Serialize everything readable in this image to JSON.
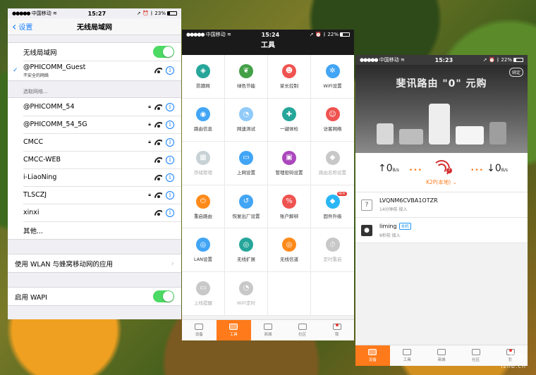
{
  "phone1": {
    "status": {
      "carrier": "中国移动",
      "time": "15:27",
      "battery": "23%",
      "battery_level": 0.23
    },
    "nav": {
      "back_label": "设置",
      "title": "无线局域网"
    },
    "wifi_toggle_label": "无线局域网",
    "connected": {
      "name": "@PHICOMM_Guest",
      "subtitle": "不安全的网络"
    },
    "choose_header": "选取网络...",
    "networks": [
      {
        "name": "@PHICOMM_54",
        "locked": true
      },
      {
        "name": "@PHICOMM_54_5G",
        "locked": true
      },
      {
        "name": "CMCC",
        "locked": true
      },
      {
        "name": "CMCC-WEB",
        "locked": false
      },
      {
        "name": "i-LiaoNing",
        "locked": false
      },
      {
        "name": "TLSCZJ",
        "locked": true
      },
      {
        "name": "xinxi",
        "locked": false
      }
    ],
    "other_label": "其他...",
    "wlan_apps_label": "使用 WLAN 与蜂窝移动网的应用",
    "wapi_label": "启用 WAPI"
  },
  "phone2": {
    "status": {
      "carrier": "中国移动",
      "time": "15:24",
      "battery": "22%",
      "battery_level": 0.22
    },
    "title": "工具",
    "tools": [
      {
        "label": "防蹭网",
        "icon": "shield-wifi-icon",
        "color": "#26a69a"
      },
      {
        "label": "绿色节能",
        "icon": "leaf-icon",
        "color": "#43a047"
      },
      {
        "label": "家长控制",
        "icon": "parent-control-icon",
        "color": "#ef5350"
      },
      {
        "label": "WiFi设置",
        "icon": "gear-icon",
        "color": "#42a5f5"
      },
      {
        "label": "路由信息",
        "icon": "globe-icon",
        "color": "#42a5f5"
      },
      {
        "label": "网速测试",
        "icon": "speedometer-icon",
        "color": "#90caf9"
      },
      {
        "label": "一键体检",
        "icon": "medical-cross-icon",
        "color": "#26a69a"
      },
      {
        "label": "访客网络",
        "icon": "guest-users-icon",
        "color": "#ef5350"
      },
      {
        "label": "存储管理",
        "icon": "storage-icon",
        "color": "#c8d2d6",
        "disabled": true
      },
      {
        "label": "上网设置",
        "icon": "network-setup-icon",
        "color": "#42a5f5"
      },
      {
        "label": "管理密码设置",
        "icon": "lock-icon",
        "color": "#ab47bc"
      },
      {
        "label": "路由名称设置",
        "icon": "tag-icon",
        "color": "#c8c8c8",
        "disabled": true
      },
      {
        "label": "重启路由",
        "icon": "restart-icon",
        "color": "#ff8a1a"
      },
      {
        "label": "恢复出厂设置",
        "icon": "factory-reset-icon",
        "color": "#42a5f5"
      },
      {
        "label": "账户解绑",
        "icon": "unbind-icon",
        "color": "#ef5350"
      },
      {
        "label": "固件升级",
        "icon": "diamond-icon",
        "color": "#29b6f6",
        "badge": "NEW"
      },
      {
        "label": "LAN设置",
        "icon": "lan-icon",
        "color": "#42a5f5"
      },
      {
        "label": "无线扩展",
        "icon": "wireless-extend-icon",
        "color": "#26a69a"
      },
      {
        "label": "无线信道",
        "icon": "wireless-channel-icon",
        "color": "#ff8a1a"
      },
      {
        "label": "定时重启",
        "icon": "timer-restart-icon",
        "color": "#c8c8c8",
        "disabled": true
      },
      {
        "label": "上线提醒",
        "icon": "online-alert-icon",
        "color": "#c8c8c8",
        "disabled": true
      },
      {
        "label": "WiFi定时",
        "icon": "wifi-timer-icon",
        "color": "#c8c8c8",
        "disabled": true
      },
      {
        "label": "",
        "icon": "",
        "color": ""
      },
      {
        "label": "",
        "icon": "",
        "color": ""
      }
    ],
    "tabs": [
      {
        "label": "设备",
        "icon": "device-icon",
        "active": false
      },
      {
        "label": "工具",
        "icon": "toolbox-icon",
        "active": true
      },
      {
        "label": "商城",
        "icon": "store-icon",
        "active": false
      },
      {
        "label": "社区",
        "icon": "community-icon",
        "active": false
      },
      {
        "label": "我",
        "icon": "profile-icon",
        "active": false
      }
    ]
  },
  "phone3": {
    "status": {
      "carrier": "中国移动",
      "time": "15:23",
      "battery": "22%",
      "battery_level": 0.22
    },
    "banner": {
      "title": "斐讯路由 \"0\" 元购",
      "bind_label": "绑定"
    },
    "speed": {
      "up_value": "0",
      "down_value": "0",
      "unit": "B/s",
      "router_name": "K2P(本地)"
    },
    "devices": [
      {
        "name": "LVQNM6CVBA1OTZR",
        "meta": "14分钟前  接入",
        "avatar": "?",
        "tag": ""
      },
      {
        "name": "liming",
        "meta": "8秒前  接入",
        "avatar": "",
        "tag": "本机"
      }
    ],
    "tabs": [
      {
        "label": "设备",
        "icon": "device-icon",
        "active": true
      },
      {
        "label": "工具",
        "icon": "toolbox-icon",
        "active": false
      },
      {
        "label": "商城",
        "icon": "store-icon",
        "active": false
      },
      {
        "label": "社区",
        "icon": "community-icon",
        "active": false
      },
      {
        "label": "我",
        "icon": "profile-icon",
        "active": false
      }
    ]
  },
  "watermark": {
    "brand": "智能",
    "site": "lzhb.cn"
  }
}
